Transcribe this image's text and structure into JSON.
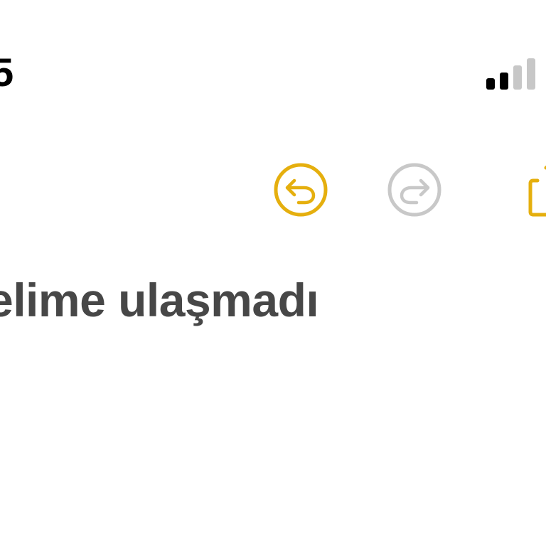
{
  "status_bar": {
    "time": "5",
    "signal_bars_active": 2,
    "signal_bars_total": 4
  },
  "toolbar": {
    "undo_icon": "undo-arrow-icon",
    "redo_icon": "redo-arrow-icon",
    "share_icon": "share-icon",
    "undo_enabled": true,
    "redo_enabled": false
  },
  "note": {
    "text": "elime ulaşmadı"
  },
  "colors": {
    "accent": "#E5AF0E",
    "disabled": "#C8C8C8",
    "text": "#474747",
    "status_text": "#000000",
    "signal_active": "#000000",
    "signal_inactive": "#C7C7C7",
    "background": "#FFFFFF"
  }
}
